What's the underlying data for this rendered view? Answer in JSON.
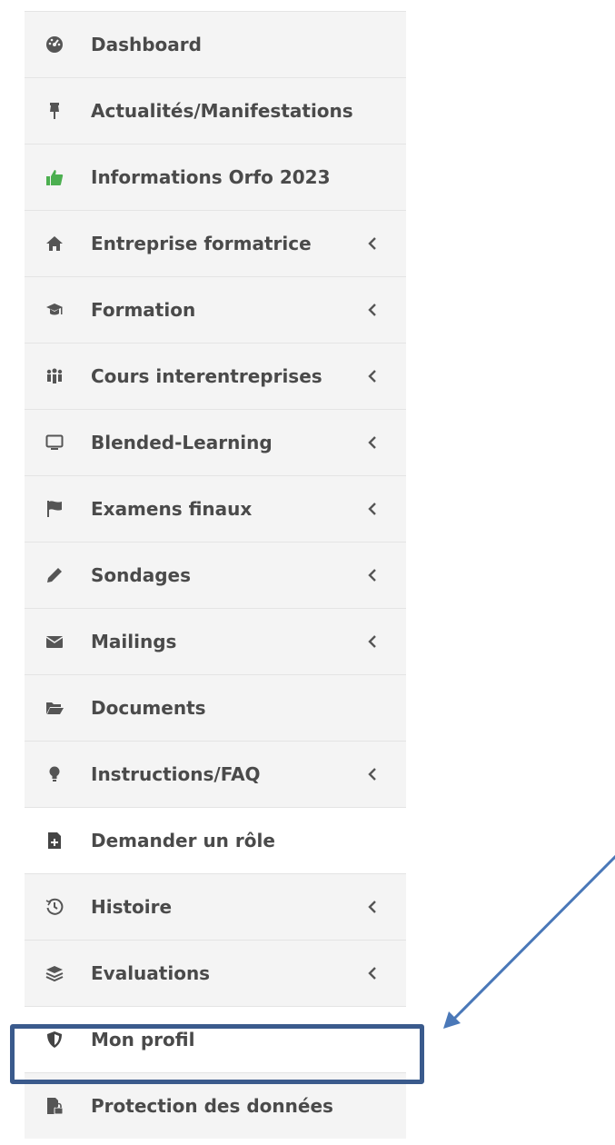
{
  "sidebar": {
    "items": [
      {
        "label": "Dashboard",
        "icon": "dashboard-gauge-icon",
        "has_submenu": false
      },
      {
        "label": "Actualités/Manifestations",
        "icon": "thumbtack-icon",
        "has_submenu": false
      },
      {
        "label": "Informations Orfo 2023",
        "icon": "thumbs-up-icon",
        "has_submenu": false
      },
      {
        "label": "Entreprise formatrice",
        "icon": "home-icon",
        "has_submenu": true
      },
      {
        "label": "Formation",
        "icon": "graduation-cap-icon",
        "has_submenu": true
      },
      {
        "label": "Cours interentreprises",
        "icon": "users-group-icon",
        "has_submenu": true
      },
      {
        "label": "Blended-Learning",
        "icon": "desktop-icon",
        "has_submenu": true
      },
      {
        "label": "Examens finaux",
        "icon": "flag-icon",
        "has_submenu": true
      },
      {
        "label": "Sondages",
        "icon": "pencil-icon",
        "has_submenu": true
      },
      {
        "label": "Mailings",
        "icon": "envelope-icon",
        "has_submenu": true
      },
      {
        "label": "Documents",
        "icon": "folder-open-icon",
        "has_submenu": false
      },
      {
        "label": "Instructions/FAQ",
        "icon": "lightbulb-icon",
        "has_submenu": true
      },
      {
        "label": "Demander un rôle",
        "icon": "file-plus-icon",
        "has_submenu": false
      },
      {
        "label": "Histoire",
        "icon": "history-clock-icon",
        "has_submenu": true
      },
      {
        "label": "Evaluations",
        "icon": "layers-icon",
        "has_submenu": true
      },
      {
        "label": "Mon profil",
        "icon": "shield-icon",
        "has_submenu": false
      },
      {
        "label": "Protection des données",
        "icon": "file-lock-icon",
        "has_submenu": false
      }
    ]
  },
  "annotation": {
    "highlighted_item": "Mon profil",
    "highlight_color": "#3a5a8c",
    "arrow_color": "#4a78b8"
  },
  "colors": {
    "sidebar_bg": "#f4f4f4",
    "text": "#4a4a4a",
    "thumbs_up_green": "#4caf50"
  }
}
